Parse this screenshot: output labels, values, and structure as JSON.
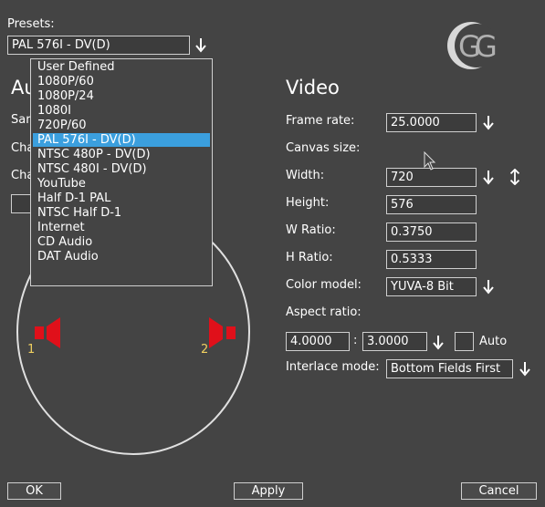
{
  "presets": {
    "label": "Presets:",
    "selected": "PAL 576I - DV(D)",
    "options": [
      "User Defined",
      "1080P/60",
      "1080P/24",
      "1080I",
      "720P/60",
      "PAL 576I - DV(D)",
      "NTSC 480P - DV(D)",
      "NTSC 480I - DV(D)",
      "YouTube",
      "Half D-1 PAL",
      "NTSC Half D-1",
      "Internet",
      "CD Audio",
      "DAT Audio"
    ],
    "selected_index": 5
  },
  "audio": {
    "heading_partial": "Au",
    "row1_partial": "Sar",
    "row2_partial": "Cha",
    "row3_partial": "Cha",
    "speaker1": "1",
    "speaker2": "2"
  },
  "video": {
    "heading": "Video",
    "frame_rate_label": "Frame rate:",
    "frame_rate": "25.0000",
    "canvas_size_label": "Canvas size:",
    "width_label": "Width:",
    "width": "720",
    "height_label": "Height:",
    "height": "576",
    "w_ratio_label": "W Ratio:",
    "w_ratio": "0.3750",
    "h_ratio_label": "H Ratio:",
    "h_ratio": "0.5333",
    "color_model_label": "Color model:",
    "color_model": "YUVA-8 Bit",
    "aspect_ratio_label": "Aspect ratio:",
    "aspect_w": "4.0000",
    "aspect_sep": ":",
    "aspect_h": "3.0000",
    "auto_label": "Auto",
    "interlace_label": "Interlace mode:",
    "interlace": "Bottom Fields First"
  },
  "buttons": {
    "ok": "OK",
    "apply": "Apply",
    "cancel": "Cancel"
  },
  "colors": {
    "background": "#444444",
    "selection": "#3b9fde",
    "speaker": "#e0101a",
    "speaker_label": "#f0d060"
  }
}
